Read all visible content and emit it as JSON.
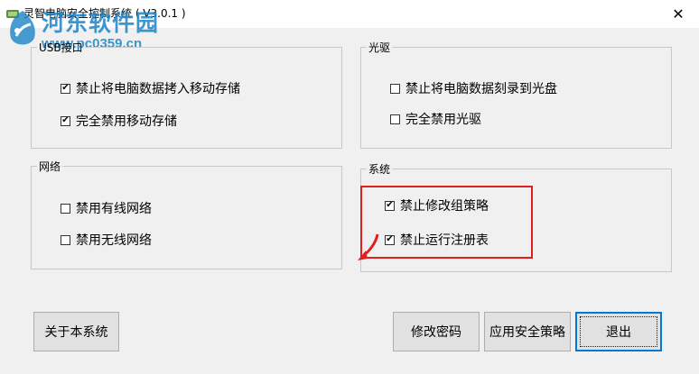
{
  "window": {
    "title": "灵智电脑安全控制系统 ( V3.0.1 )",
    "close_glyph": "✕"
  },
  "watermark": {
    "site_name": "河东软件园",
    "url": "www.pc0359.cn"
  },
  "groups": {
    "usb": {
      "legend": "USB接口",
      "items": [
        {
          "label": "禁止将电脑数据拷入移动存储",
          "checked": true
        },
        {
          "label": "完全禁用移动存储",
          "checked": true
        }
      ]
    },
    "optical": {
      "legend": "光驱",
      "items": [
        {
          "label": "禁止将电脑数据刻录到光盘",
          "checked": false
        },
        {
          "label": "完全禁用光驱",
          "checked": false
        }
      ]
    },
    "network": {
      "legend": "网络",
      "items": [
        {
          "label": "禁用有线网络",
          "checked": false
        },
        {
          "label": "禁用无线网络",
          "checked": false
        }
      ]
    },
    "system": {
      "legend": "系统",
      "items": [
        {
          "label": "禁止修改组策略",
          "checked": true
        },
        {
          "label": "禁止运行注册表",
          "checked": true
        }
      ]
    }
  },
  "buttons": {
    "about": "关于本系统",
    "change_password": "修改密码",
    "apply_policy": "应用安全策略",
    "exit": "退出"
  },
  "colors": {
    "highlight": "#e0201f",
    "watermark": "#1c84c8",
    "accent": "#0078d7"
  }
}
